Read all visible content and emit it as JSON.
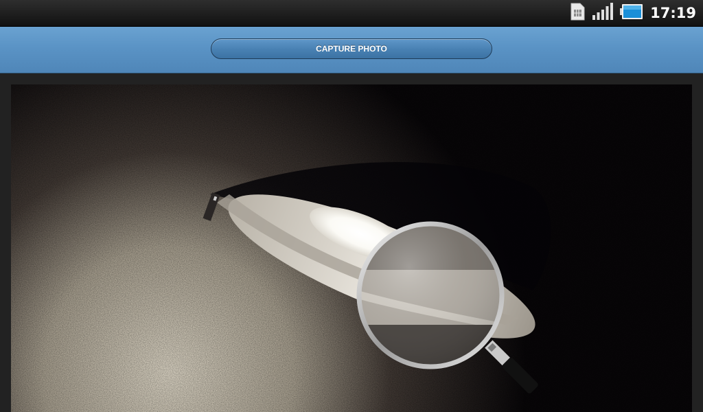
{
  "status_bar": {
    "time": "17:19",
    "icons": [
      "sim-card-icon",
      "signal-icon",
      "battery-icon"
    ]
  },
  "header": {
    "capture_button_label": "CAPTURE PHOTO"
  },
  "photo": {
    "subject": "magnifier",
    "icon": "magnifying-glass-icon"
  },
  "colors": {
    "header_blue": "#5a93c5",
    "button_blue": "#4a82b4",
    "status_bar": "#1a1a1a"
  }
}
